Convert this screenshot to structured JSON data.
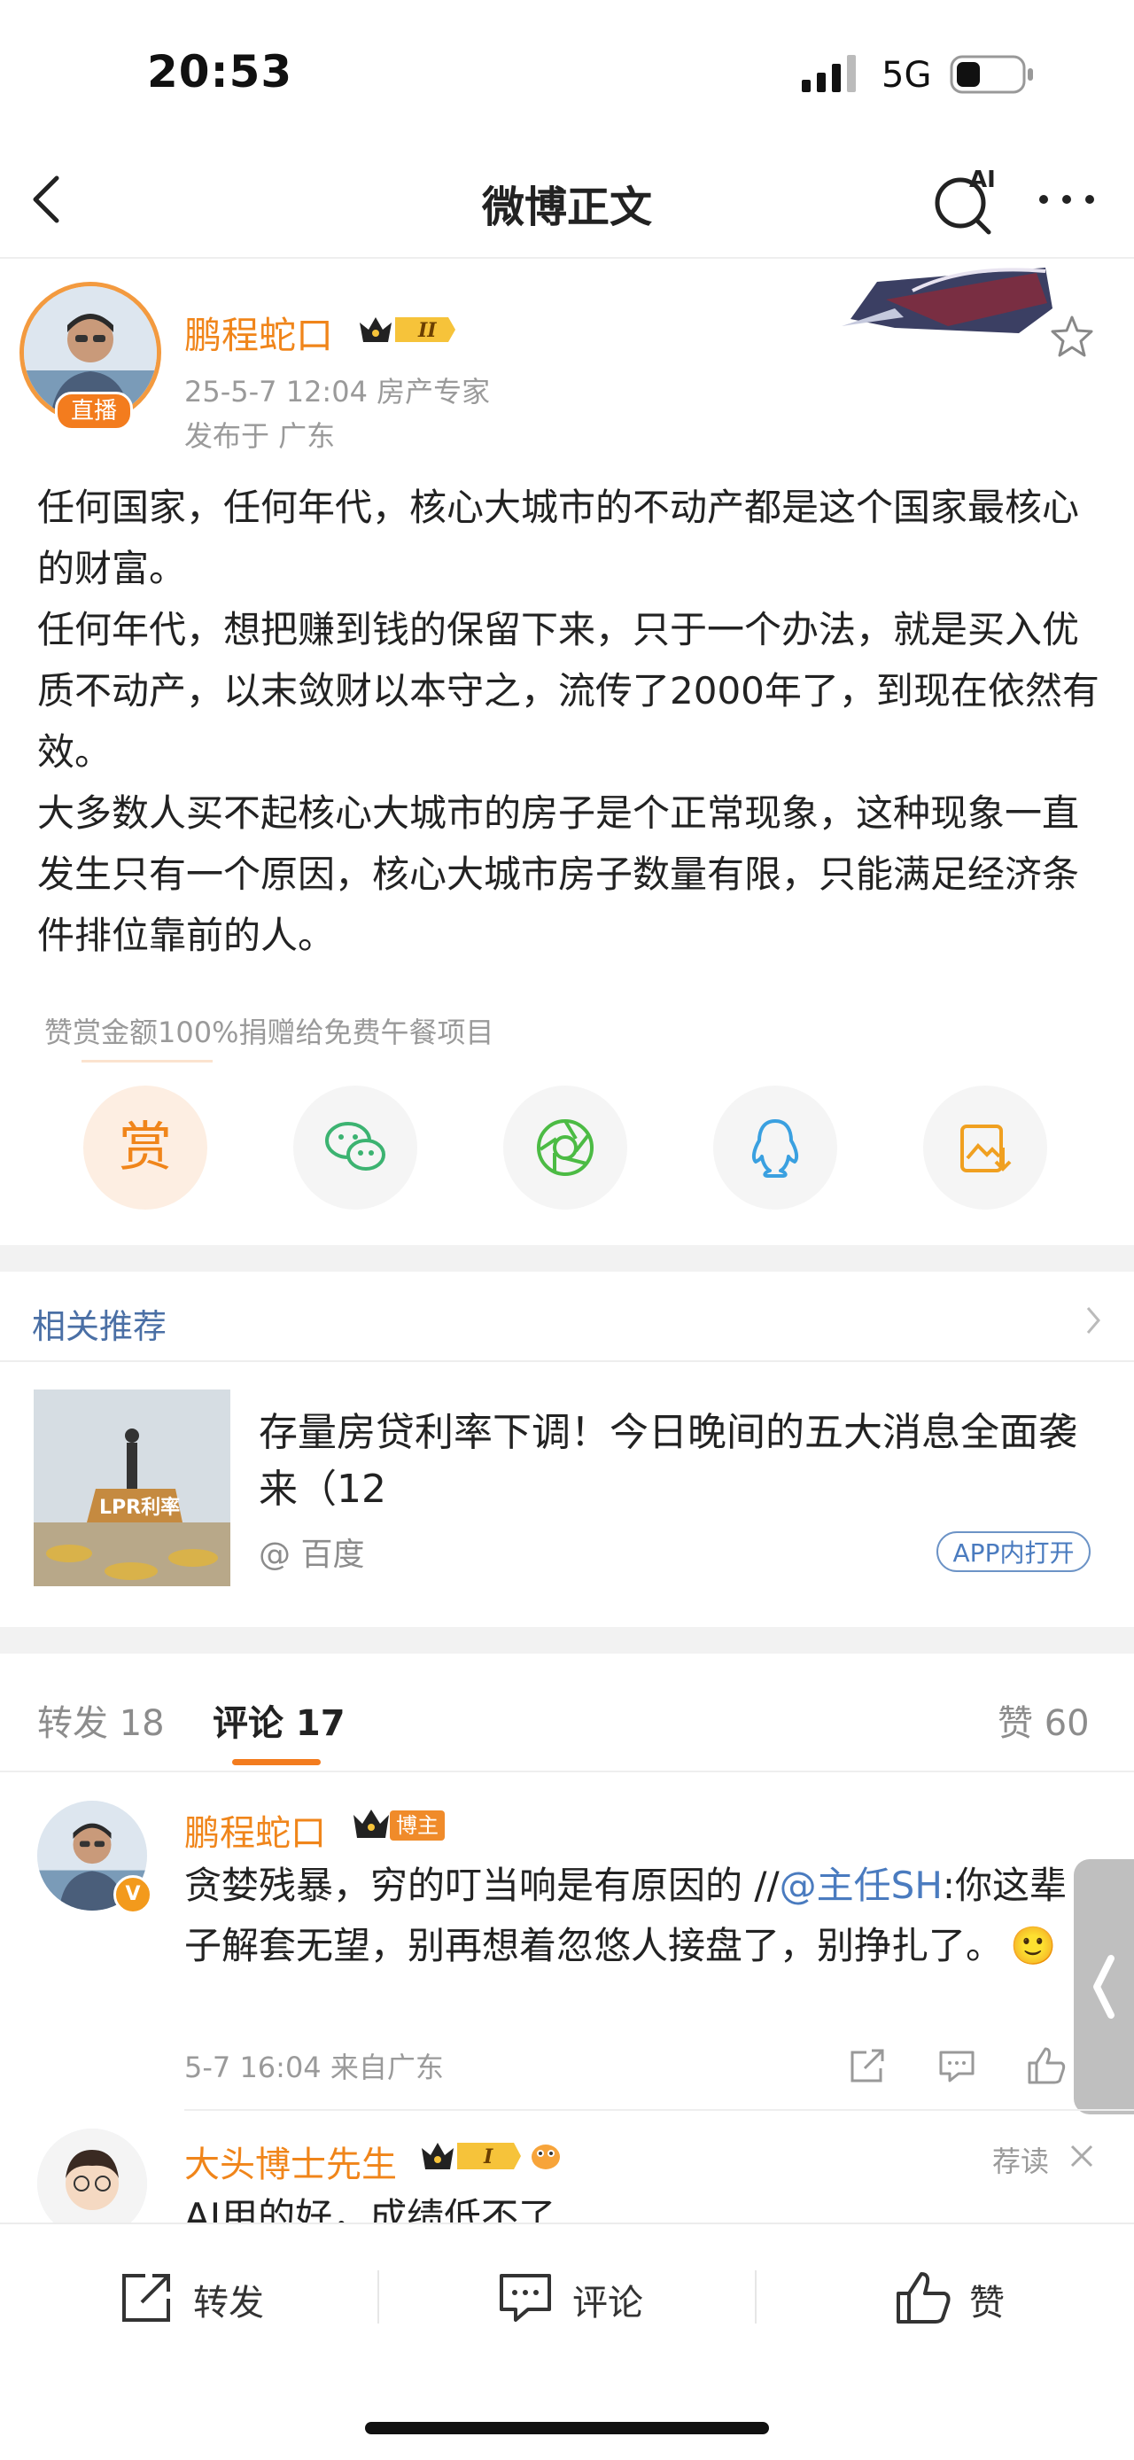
{
  "status_bar": {
    "time": "20:53",
    "network": "5G"
  },
  "nav": {
    "title": "微博正文",
    "ai_label": "AI"
  },
  "post": {
    "author": "鹏程蛇口",
    "live_badge": "直播",
    "vip_level": "II",
    "meta": "25-5-7 12:04  房产专家",
    "location": "发布于 广东",
    "text": "任何国家，任何年代，核心大城市的不动产都是这个国家最核心的财富。\n任何年代，想把赚到钱的保留下来，只于一个办法，就是买入优质不动产，以末敛财以本守之，流传了2000年了，到现在依然有效。\n大多数人买不起核心大城市的房子是个正常现象，这种现象一直发生只有一个原因，核心大城市房子数量有限，只能满足经济条件排位靠前的人。",
    "reward_note": "赞赏金额100%捐赠给免费午餐项目",
    "reward_label": "赏"
  },
  "related": {
    "title": "相关推荐",
    "headline": "存量房贷利率下调！今日晚间的五大消息全面袭来（12",
    "source": "@ 百度",
    "app_open": "APP内打开",
    "thumb_label": "LPR利率"
  },
  "tabs": {
    "forward": "转发 18",
    "comment": "评论 17",
    "like": "赞 60"
  },
  "comments": [
    {
      "name": "鹏程蛇口",
      "owner_badge": "博主",
      "v_badge": "V",
      "text_main": "贪婪残暴，穷的叮当响是有原因的 //",
      "mention": "@主任SH",
      "text_rest": ":你这辈子解套无望，别再想着忽悠人接盘了，别挣扎了。",
      "emoji": "🙂",
      "meta": "5-7 16:04  来自广东"
    },
    {
      "name": "大头博士先生",
      "vip_level": "I",
      "recommend": "荐读",
      "text": "AI用的好，成绩低不了"
    }
  ],
  "bottom_bar": {
    "forward": "转发",
    "comment": "评论",
    "like": "赞"
  },
  "colors": {
    "accent": "#f0851a",
    "link": "#4a7bbf",
    "muted": "#9a9a9a"
  }
}
